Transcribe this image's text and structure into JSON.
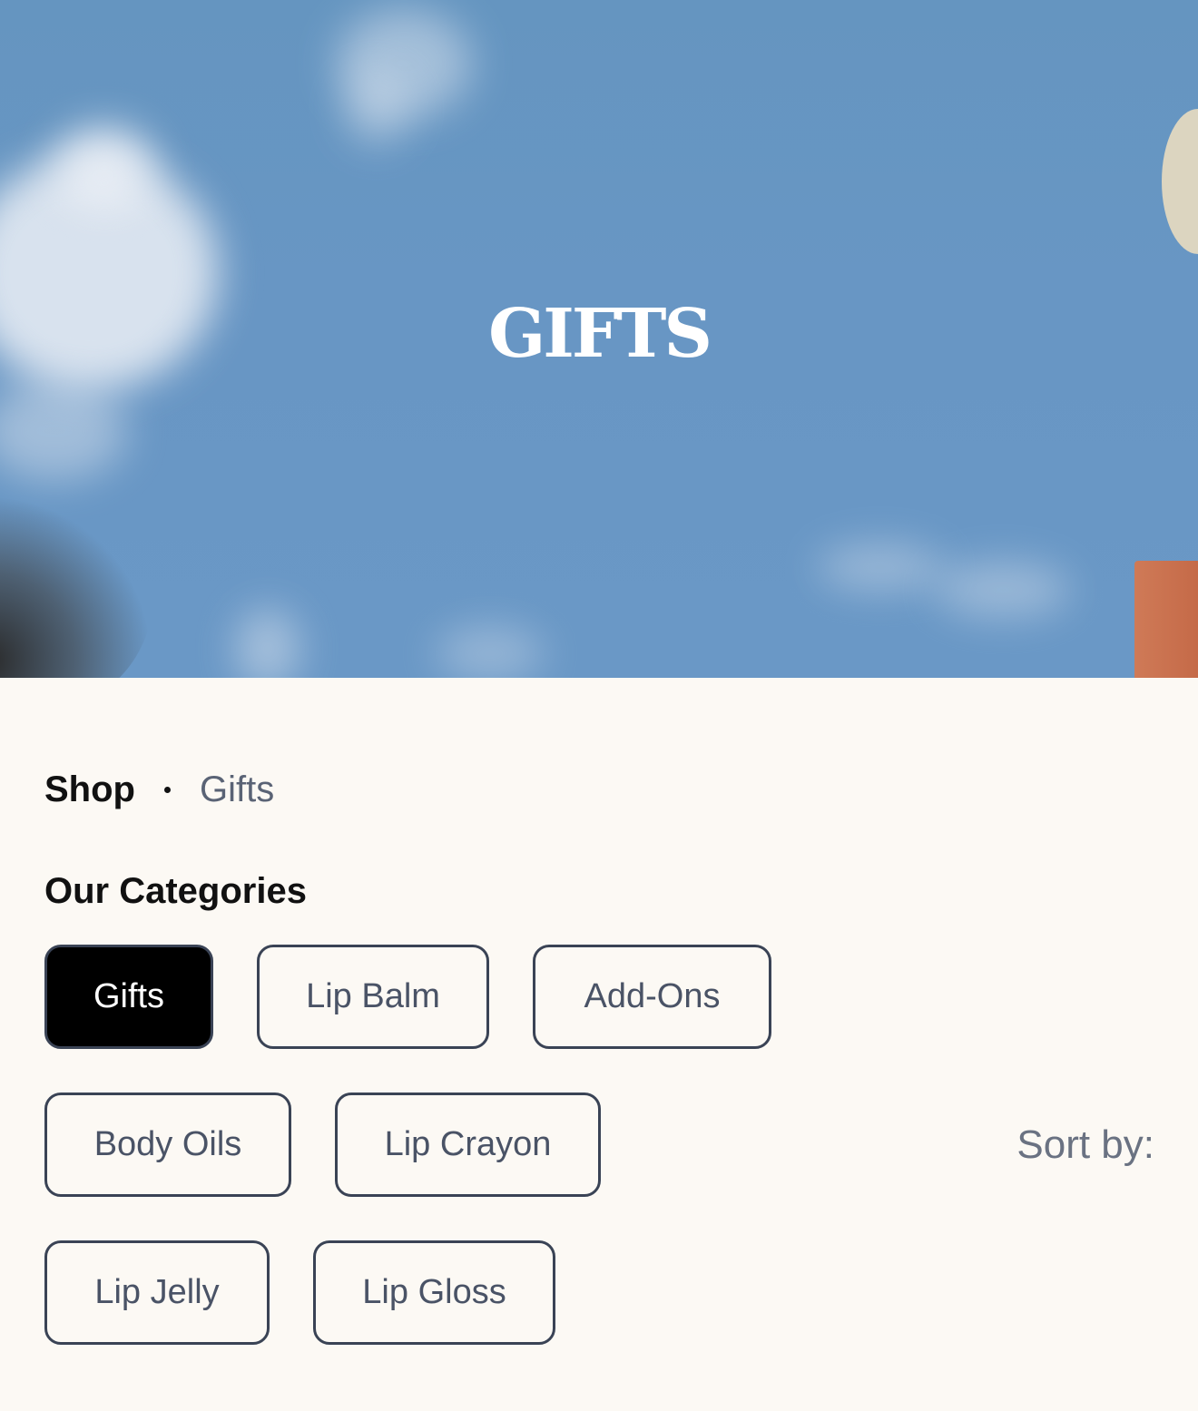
{
  "hero": {
    "title": "GIFTS"
  },
  "breadcrumb": {
    "root": "Shop",
    "current": "Gifts"
  },
  "categories": {
    "heading": "Our Categories",
    "items": [
      {
        "label": "Gifts",
        "active": true
      },
      {
        "label": "Lip Balm",
        "active": false
      },
      {
        "label": "Add-Ons",
        "active": false
      },
      {
        "label": "Body Oils",
        "active": false
      },
      {
        "label": "Lip Crayon",
        "active": false
      },
      {
        "label": "Lip Jelly",
        "active": false
      },
      {
        "label": "Lip Gloss",
        "active": false
      }
    ]
  },
  "sort": {
    "label": "Sort by:"
  },
  "colors": {
    "page_bg": "#fcf9f4",
    "hero_sky": "#6896c4",
    "active_bg": "#000000",
    "border": "#3a4355"
  }
}
